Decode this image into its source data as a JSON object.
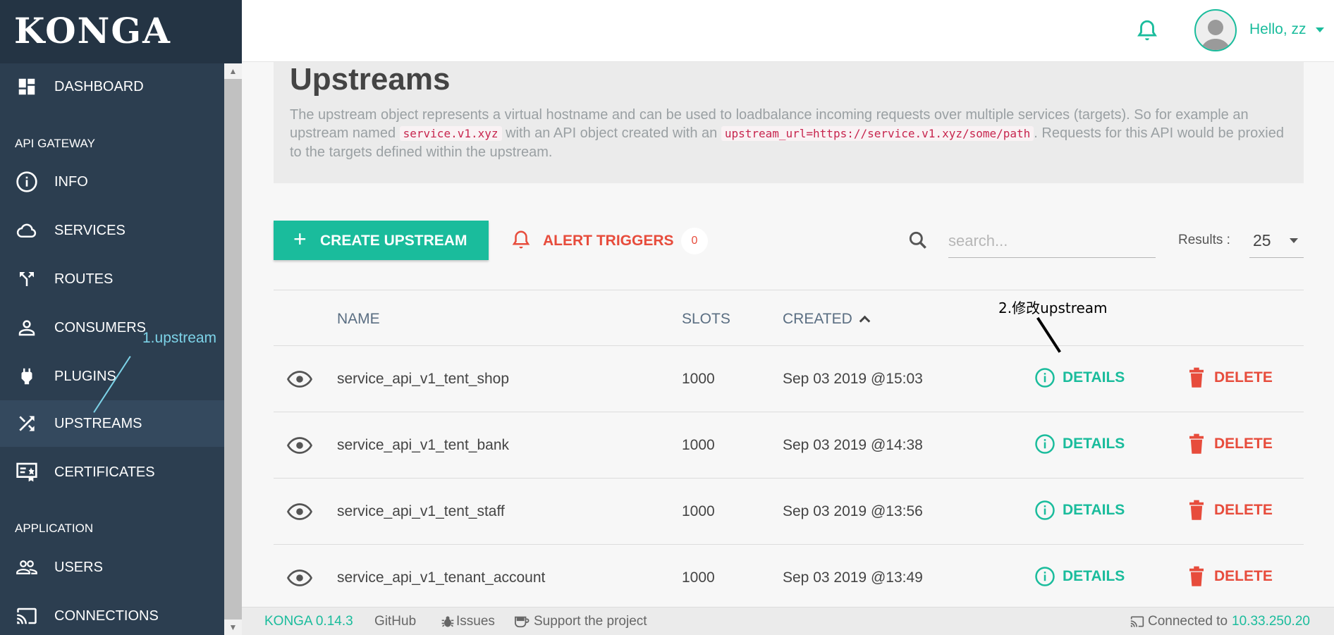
{
  "brand": "KONGA",
  "header": {
    "greeting": "Hello, zz"
  },
  "sidebar": {
    "items": [
      {
        "label": "DASHBOARD",
        "icon": "dashboard-icon"
      },
      {
        "label": "INFO",
        "icon": "info-icon"
      },
      {
        "label": "SERVICES",
        "icon": "cloud-icon"
      },
      {
        "label": "ROUTES",
        "icon": "route-fork-icon"
      },
      {
        "label": "CONSUMERS",
        "icon": "person-icon"
      },
      {
        "label": "PLUGINS",
        "icon": "plug-icon"
      },
      {
        "label": "UPSTREAMS",
        "icon": "shuffle-icon",
        "active": true
      },
      {
        "label": "CERTIFICATES",
        "icon": "certificate-icon"
      },
      {
        "label": "USERS",
        "icon": "people-icon"
      },
      {
        "label": "CONNECTIONS",
        "icon": "cast-icon"
      }
    ],
    "sections": {
      "api_gateway": "API GATEWAY",
      "application": "APPLICATION"
    }
  },
  "page": {
    "title": "Upstreams",
    "description_1": "The upstream object represents a virtual hostname and can be used to loadbalance incoming requests over multiple services (targets). So for example an upstream named",
    "code_1": "service.v1.xyz",
    "description_2": "with an API object created with an",
    "code_2": "upstream_url=https://service.v1.xyz/some/path",
    "description_3": ". Requests for this API would be proxied to the targets defined within the upstream."
  },
  "toolbar": {
    "create_plus": "+",
    "create_label": "CREATE UPSTREAM",
    "alert_label": "ALERT TRIGGERS",
    "alert_count": "0",
    "search_placeholder": "search...",
    "results_label": "Results :",
    "results_value": "25"
  },
  "table": {
    "headers": {
      "name": "NAME",
      "slots": "SLOTS",
      "created": "CREATED"
    },
    "details_label": "DETAILS",
    "delete_label": "DELETE",
    "rows": [
      {
        "name": "service_api_v1_tent_shop",
        "slots": "1000",
        "created": "Sep 03 2019 @15:03"
      },
      {
        "name": "service_api_v1_tent_bank",
        "slots": "1000",
        "created": "Sep 03 2019 @14:38"
      },
      {
        "name": "service_api_v1_tent_staff",
        "slots": "1000",
        "created": "Sep 03 2019 @13:56"
      },
      {
        "name": "service_api_v1_tenant_account",
        "slots": "1000",
        "created": "Sep 03 2019 @13:49"
      }
    ]
  },
  "annotations": {
    "a1": "1.upstream",
    "a2": "2.修改upstream"
  },
  "footer": {
    "version": "KONGA 0.14.3",
    "github": "GitHub",
    "issues": "Issues",
    "support": "Support the project",
    "connected_prefix": "Connected to",
    "connected_host": "10.33.250.20"
  },
  "colors": {
    "accent": "#1abc9c",
    "danger": "#e74c3c",
    "sidebar": "#2c3e50"
  }
}
